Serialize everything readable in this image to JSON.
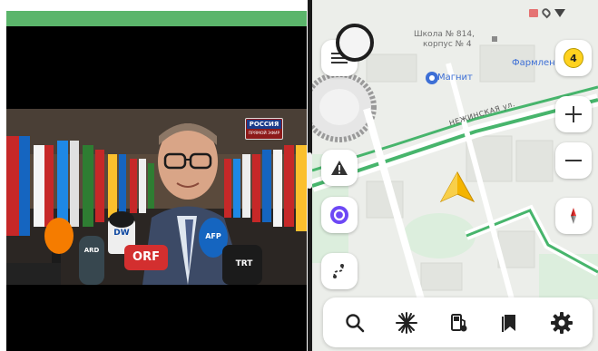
{
  "colors": {
    "top_bar": "#5bb56b",
    "map_bg": "#eceeea",
    "road_green": "#47b56c",
    "accent_blue": "#3d6fd6",
    "alice_purple": "#6d48f5",
    "cursor_yellow": "#f4b400",
    "traffic_yellow": "#ffd21f"
  },
  "video": {
    "channel_logo_line1": "РОССИЯ",
    "channel_logo_line2": "ПРЯМОЙ ЭФИР",
    "mic_logos": [
      "ORF",
      "DW",
      "ARD",
      "AFP",
      "TRT"
    ]
  },
  "map": {
    "school_label_line1": "Школа № 814,",
    "school_label_line2": "корпус № 4",
    "store_label": "Магнит",
    "pharmacy_label": "Фармлен",
    "street_label": "НЕЖИНСКАЯ ул."
  },
  "controls": {
    "traffic_level": "4",
    "left_buttons": [
      "menu-icon",
      "warning-icon",
      "alice-icon",
      "route-icon"
    ],
    "right_buttons": [
      "zoom-in-icon",
      "zoom-out-icon",
      "compass-icon"
    ]
  },
  "toolbar": {
    "items": [
      "search-icon",
      "discovery-icon",
      "fuel-icon",
      "bookmarks-icon",
      "settings-icon"
    ]
  },
  "status_bar": {
    "icons": [
      "photo-icon",
      "location-icon",
      "signal-icon"
    ]
  }
}
